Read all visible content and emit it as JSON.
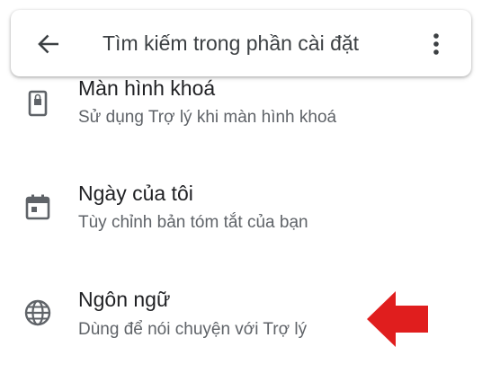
{
  "search": {
    "placeholder": "Tìm kiếm trong phần cài đặt",
    "back_icon": "arrow-back-icon",
    "more_icon": "more-vert-icon"
  },
  "items": [
    {
      "title": "Màn hình khoá",
      "subtitle": "Sử dụng Trợ lý khi màn hình khoá",
      "icon": "lock-screen-icon"
    },
    {
      "title": "Ngày của tôi",
      "subtitle": "Tùy chỉnh bản tóm tắt của bạn",
      "icon": "calendar-icon"
    },
    {
      "title": "Ngôn ngữ",
      "subtitle": "Dùng để nói chuyện với Trợ lý",
      "icon": "globe-icon"
    }
  ],
  "annotation": {
    "arrow_icon": "red-arrow-icon",
    "arrow_color": "#e01e1e"
  },
  "colors": {
    "title": "#202124",
    "subtitle": "#5f6368",
    "icon": "#5f6368"
  }
}
